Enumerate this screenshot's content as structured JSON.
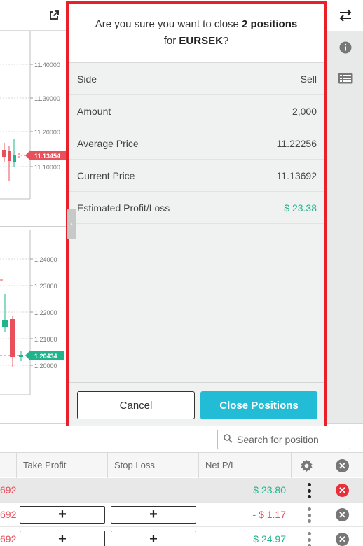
{
  "modal": {
    "title_pre": "Are you sure you want to close ",
    "title_bold": "2 positions",
    "title_line2_pre": "for ",
    "title_symbol": "EURSEK",
    "title_suffix": "?",
    "rows": [
      {
        "label": "Side",
        "value": "Sell"
      },
      {
        "label": "Amount",
        "value": "2,000"
      },
      {
        "label": "Average Price",
        "value": "11.22256"
      },
      {
        "label": "Current Price",
        "value": "11.13692"
      },
      {
        "label": "Estimated Profit/Loss",
        "value": "$ 23.38"
      }
    ],
    "cancel_label": "Cancel",
    "confirm_label": "Close Positions",
    "accent_color": "#22bcd6",
    "profit_color": "#1fb48c"
  },
  "chart_top": {
    "ticks": [
      "11.40000",
      "11.30000",
      "11.20000",
      "11.10000"
    ],
    "price_badge": "11.13454",
    "badge_color": "#e8505b"
  },
  "chart_bottom": {
    "ticks": [
      "1.24000",
      "1.23000",
      "1.22000",
      "1.21000",
      "1.20000"
    ],
    "price_badge": "1.20434",
    "badge_color": "#1fb48c"
  },
  "toolbar": {
    "icons": [
      "swap-icon",
      "info-icon",
      "list-icon"
    ]
  },
  "bottom": {
    "search_placeholder": "Search for position",
    "columns": [
      "Take Profit",
      "Stop Loss",
      "Net P/L"
    ],
    "rows": [
      {
        "left": "692",
        "pnl": "$ 23.80"
      },
      {
        "left": "692",
        "pnl": "- $ 1.17"
      },
      {
        "left": "692",
        "pnl": "$ 24.97"
      }
    ],
    "plus_glyph": "+"
  }
}
